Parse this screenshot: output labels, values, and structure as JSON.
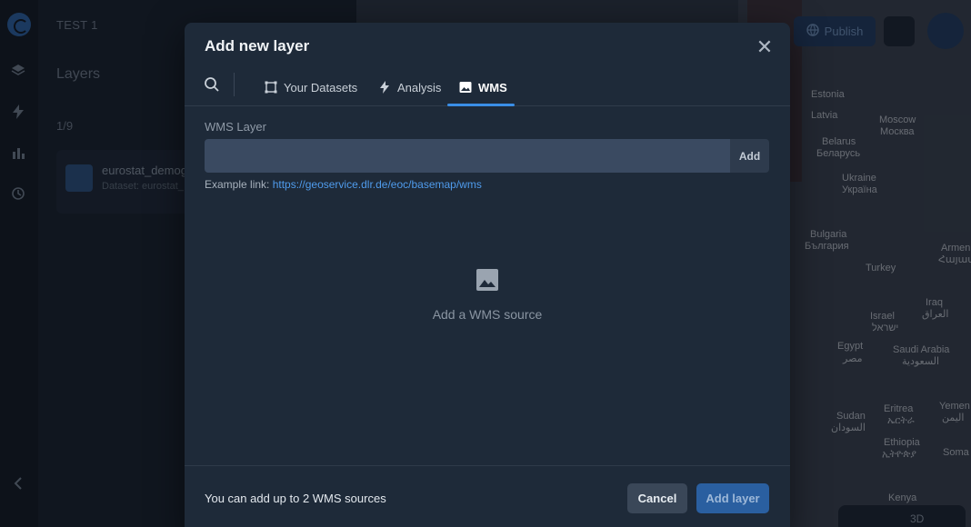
{
  "app": {
    "project_name": "TEST 1",
    "layers_title": "Layers",
    "layers_count": "1/9",
    "layer_item": {
      "name": "eurostat_demog",
      "subtitle": "Dataset: eurostat_"
    },
    "publish_label": "Publish"
  },
  "map": {
    "labels": [
      "Estonia",
      "Latvia",
      "Moscow",
      "Москва",
      "Belarus",
      "Беларусь",
      "Ukraine",
      "Україна",
      "Bulgaria",
      "България",
      "Armenia",
      "Հայաստան",
      "Turkey",
      "Iraq",
      "العراق",
      "Israel",
      "ישראל",
      "Egypt",
      "مصر",
      "Saudi Arabia",
      "السعودية",
      "Sudan",
      "السودان",
      "Eritrea",
      "ኤርትራ",
      "Yemen",
      "اليمن",
      "Ethiopia",
      "ኢትዮጵያ",
      "Soma",
      "Kenya",
      "3D"
    ]
  },
  "modal": {
    "title": "Add new layer",
    "tabs": [
      {
        "label": "Your Datasets",
        "icon": "dataset-frame-icon"
      },
      {
        "label": "Analysis",
        "icon": "lightning-icon"
      },
      {
        "label": "WMS",
        "icon": "image-icon",
        "active": true
      }
    ],
    "wms_layer_label": "WMS Layer",
    "wms_input": {
      "value": "",
      "placeholder": ""
    },
    "add_label": "Add",
    "example_prefix": "Example link:",
    "example_link": "https://geoservice.dlr.de/eoc/basemap/wms",
    "empty_state_text": "Add a WMS source",
    "footer_note": "You can add up to 2 WMS sources",
    "cancel_label": "Cancel",
    "add_layer_label": "Add layer"
  },
  "colors": {
    "accent": "#3a8ee6",
    "modal_bg": "#1e2a39",
    "input_bg": "#3a4a61",
    "primary_button": "#2a5fa0"
  }
}
